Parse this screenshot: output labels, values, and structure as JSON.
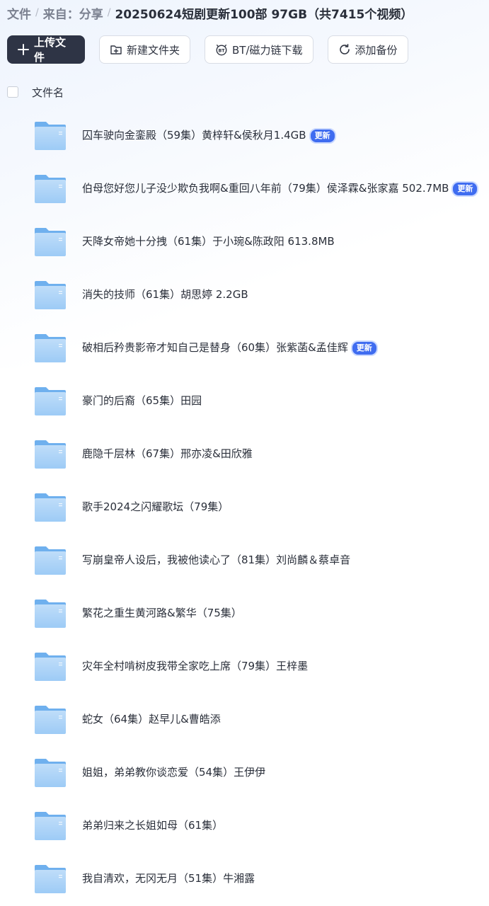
{
  "breadcrumb": {
    "root": "文件",
    "source_label": "来自：分享",
    "current": "20250624短剧更新100部 97GB（共7415个视频）"
  },
  "toolbar": {
    "upload_label": "上传文件",
    "new_folder_label": "新建文件夹",
    "bt_label": "BT/磁力链下载",
    "backup_label": "添加备份"
  },
  "list": {
    "column_name": "文件名",
    "items": [
      {
        "name": "囚车驶向金銮殿（59集）黄梓轩&侯秋月1.4GB",
        "badge": "更新"
      },
      {
        "name": "伯母您好您儿子没少欺负我啊&重回八年前（79集）侯泽霖&张家嘉 502.7MB",
        "badge": "更新"
      },
      {
        "name": "天降女帝她十分拽（61集）于小琬&陈政阳 613.8MB",
        "badge": ""
      },
      {
        "name": "消失的技师（61集）胡思婷 2.2GB",
        "badge": ""
      },
      {
        "name": "破相后矜贵影帝才知自己是替身（60集）张紫菡&孟佳辉",
        "badge": "更新"
      },
      {
        "name": "豪门的后裔（65集）田园",
        "badge": ""
      },
      {
        "name": "鹿隐千层林（67集）邢亦凌&田欣雅",
        "badge": ""
      },
      {
        "name": "歌手2024之闪耀歌坛（79集）",
        "badge": ""
      },
      {
        "name": "写崩皇帝人设后，我被他读心了（81集）刘尚麟＆蔡卓音",
        "badge": ""
      },
      {
        "name": "繁花之重生黄河路&繁华（75集）",
        "badge": ""
      },
      {
        "name": "灾年全村啃树皮我带全家吃上席（79集）王梓墨",
        "badge": ""
      },
      {
        "name": "蛇女（64集）赵早儿&曹皓添",
        "badge": ""
      },
      {
        "name": "姐姐，弟弟教你谈恋爱（54集）王伊伊",
        "badge": ""
      },
      {
        "name": "弟弟归来之长姐如母（61集）",
        "badge": ""
      },
      {
        "name": "我自清欢，无冈无月（51集）牛湘露",
        "badge": ""
      }
    ]
  },
  "icons": {
    "plus": "plus-icon",
    "new_folder": "folder-plus-icon",
    "bt": "bt-icon",
    "backup": "sync-icon",
    "folder": "folder-icon"
  },
  "colors": {
    "primary_button": "#2e3445",
    "badge": "#3f6cf0",
    "folder": "#8ec3f4"
  }
}
